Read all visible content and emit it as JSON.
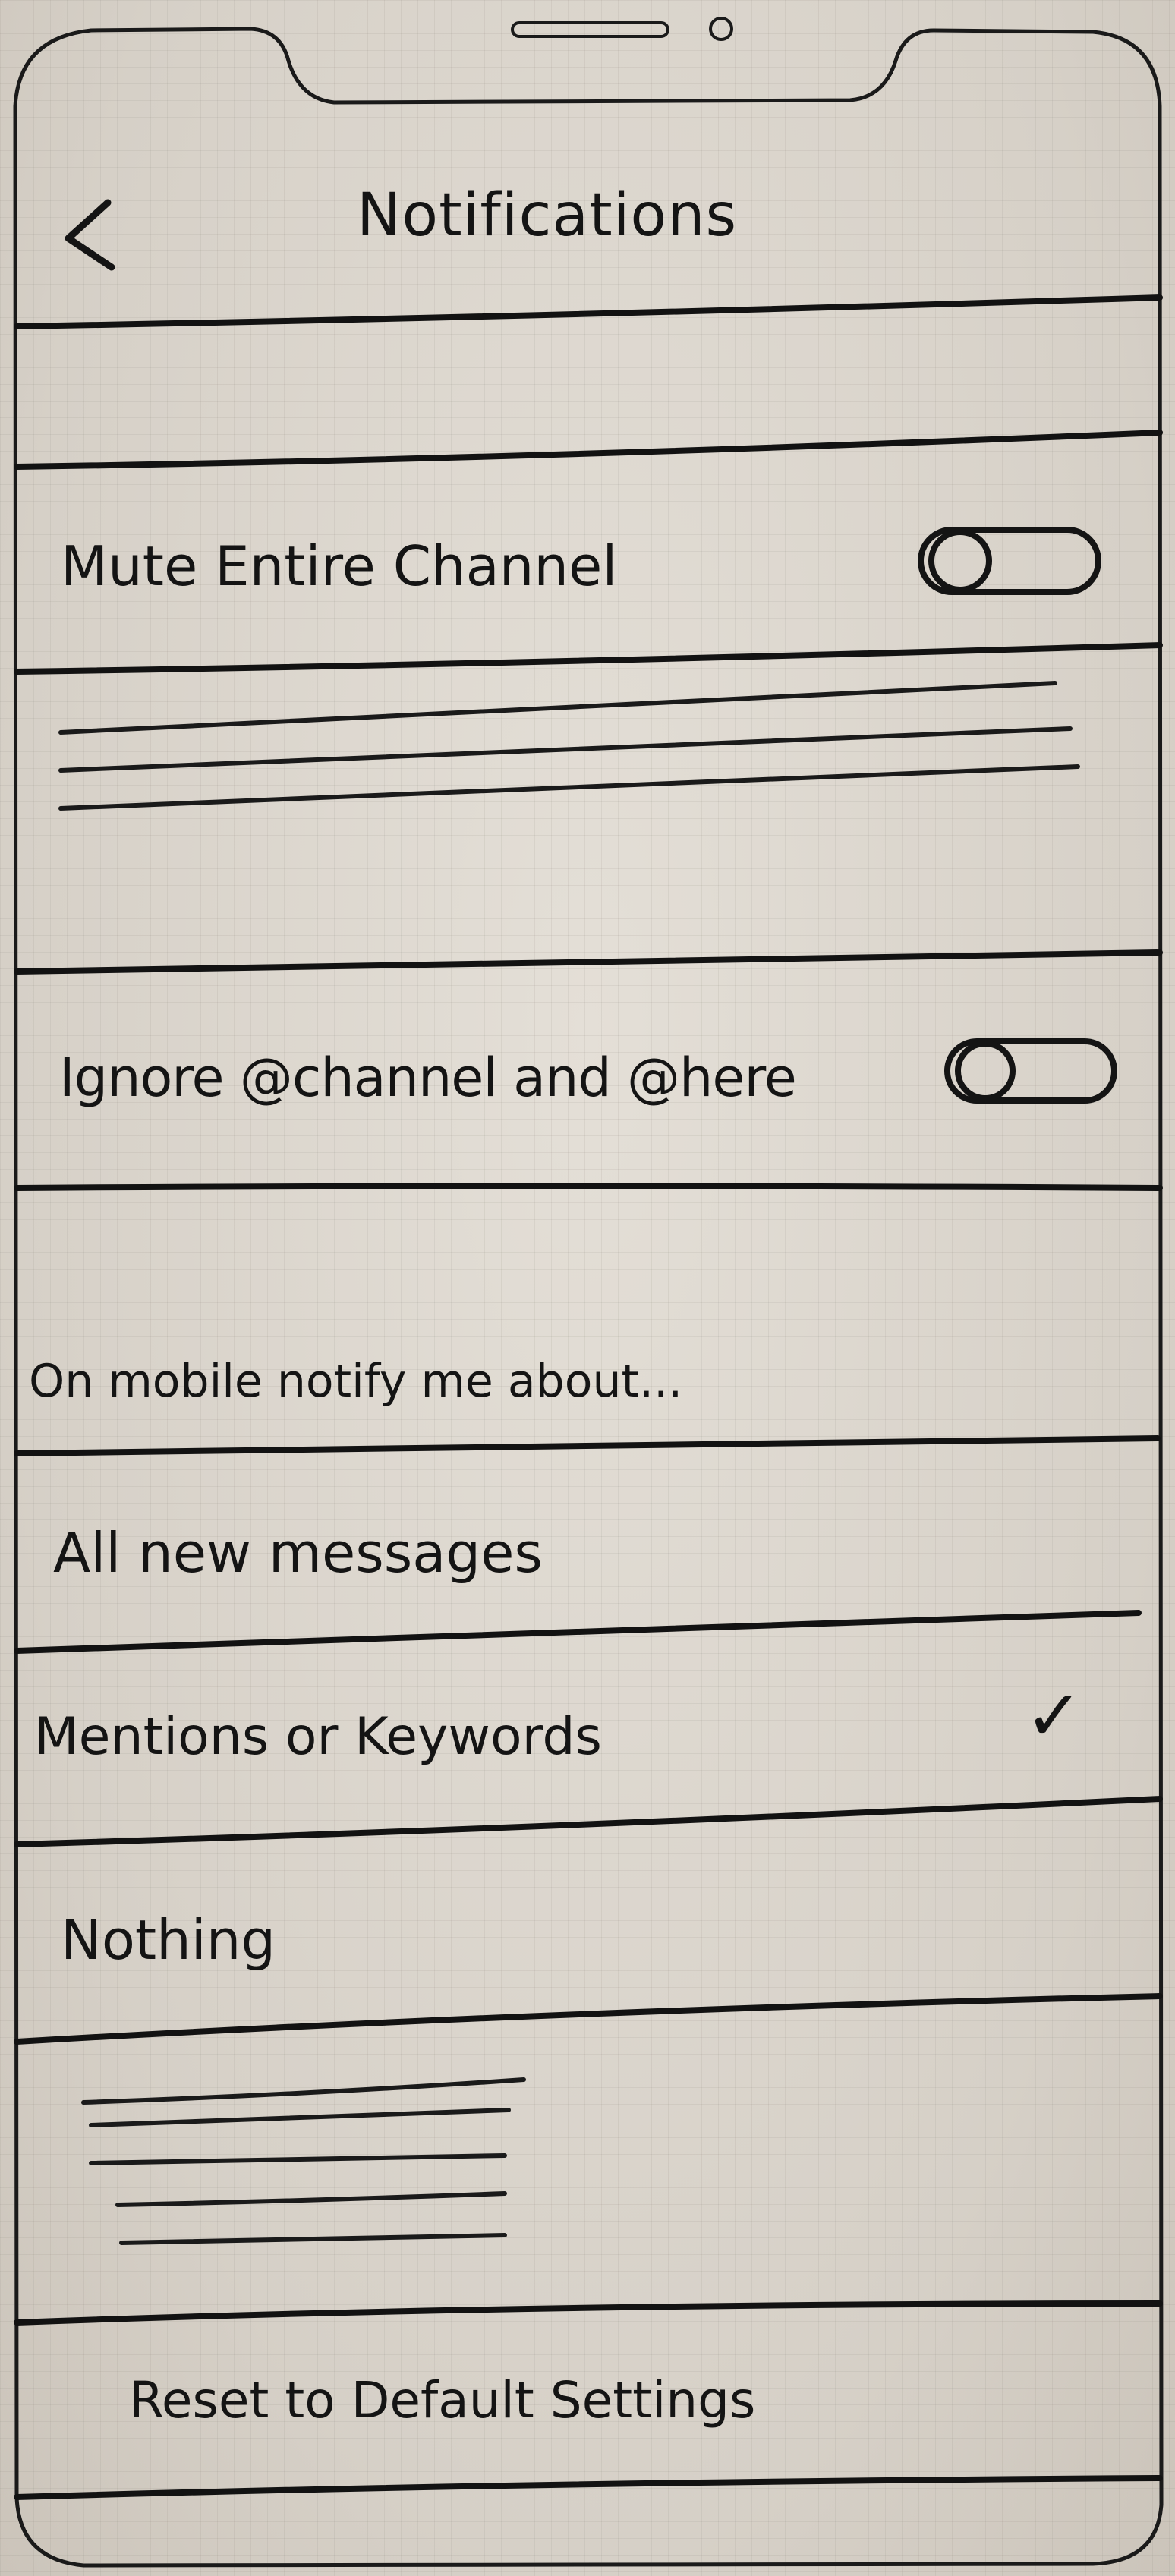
{
  "header": {
    "title": "Notifications"
  },
  "channel_settings": {
    "mute_label": "Mute Entire Channel",
    "mute_on": false,
    "ignore_label": "Ignore @channel and @here",
    "ignore_on": false
  },
  "mobile_notifications": {
    "heading": "On mobile notify me about...",
    "options": [
      {
        "label": "All new messages",
        "selected": false
      },
      {
        "label": "Mentions or Keywords",
        "selected": true
      },
      {
        "label": "Nothing",
        "selected": false
      }
    ],
    "check_mark": "✓"
  },
  "footer": {
    "reset_label": "Reset to Default Settings"
  },
  "icons": {
    "back": "chevron-left-icon",
    "toggle": "toggle-switch-icon",
    "check": "checkmark-icon"
  }
}
